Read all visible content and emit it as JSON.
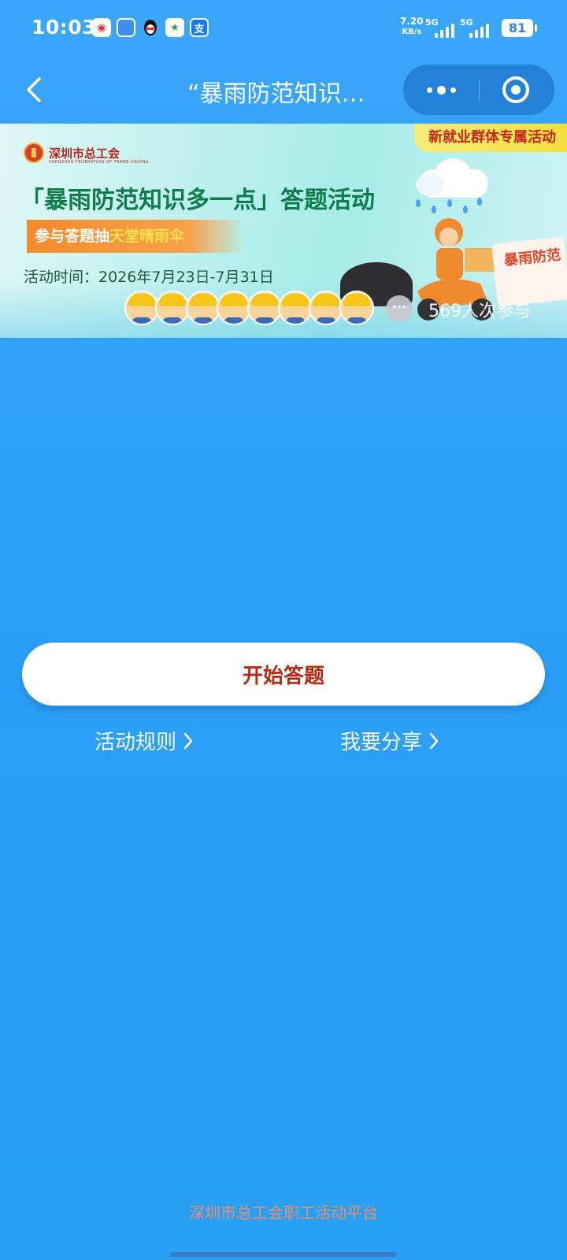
{
  "status_bar": {
    "time": "10:03",
    "net_speed_value": "7.20",
    "net_speed_unit": "KB/s",
    "signal_1": "5G",
    "signal_2": "5G",
    "battery": "81",
    "notification_icons": [
      "app-red-icon",
      "app-blue-icon",
      "qq-penguin-icon",
      "app-green-icon",
      "alipay-icon"
    ]
  },
  "nav": {
    "title": "“暴雨防范知识…",
    "back_icon": "chevron-left-icon",
    "more_icon": "more-dots-icon",
    "close_icon": "target-circle-icon"
  },
  "banner": {
    "tag": "新就业群体专属活动",
    "org_name": "深圳市总工会",
    "org_name_en": "SHENZHEN FEDERATION OF TRADE UNIONS",
    "headline": "「暴雨防范知识多一点」答题活动",
    "subtitle_prefix": "参与答题抽",
    "subtitle_highlight": "天堂晴雨伞",
    "date": "活动时间：2026年7月23日-7月31日",
    "participants": "569人次参与",
    "side_paper_text": "暴雨防范"
  },
  "actions": {
    "start_label": "开始答题",
    "rules_label": "活动规则",
    "share_label": "我要分享"
  },
  "footer": {
    "text": "深圳市总工会职工活动平台"
  },
  "colors": {
    "background": "#2c9ff6",
    "start_text": "#b52a12",
    "footer_text": "#f08a6a",
    "headline": "#0d7d4c"
  }
}
